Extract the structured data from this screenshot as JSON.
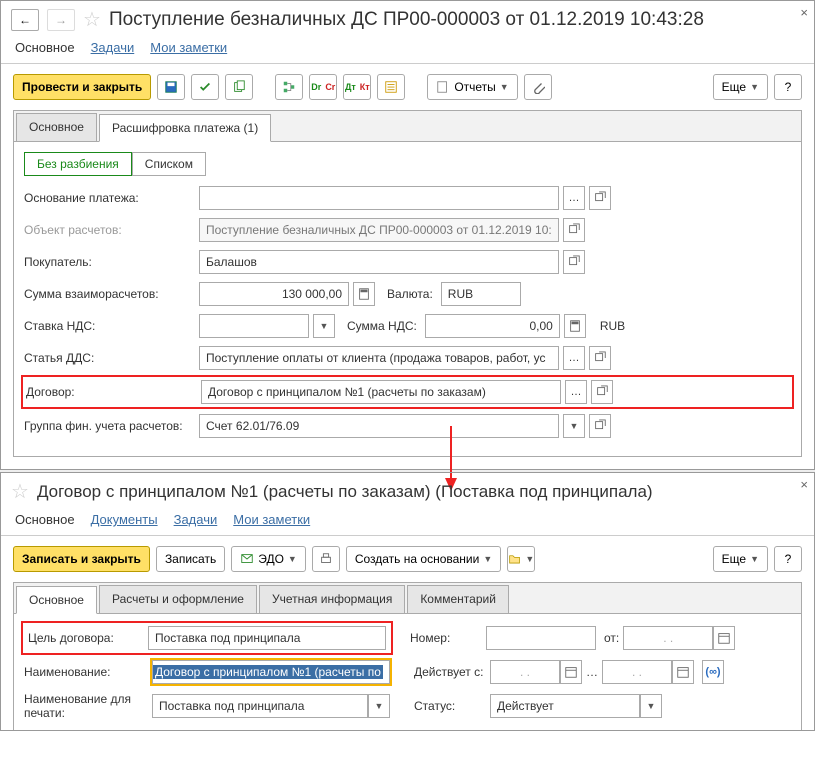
{
  "top": {
    "title": "Поступление безналичных ДС ПР00-000003 от 01.12.2019 10:43:28",
    "nav": {
      "main": "Основное",
      "tasks": "Задачи",
      "notes": "Мои заметки"
    },
    "toolbar": {
      "post_close": "Провести и закрыть",
      "reports": "Отчеты",
      "more": "Еще"
    },
    "main_tabs": {
      "t1": "Основное",
      "t2": "Расшифровка платежа (1)"
    },
    "toggle": {
      "t1": "Без разбиения",
      "t2": "Списком"
    },
    "fields": {
      "basis_label": "Основание платежа:",
      "basis_value": "",
      "calcobj_label": "Объект расчетов:",
      "calcobj_value": "Поступление безналичных ДС ПР00-000003 от 01.12.2019 10:",
      "buyer_label": "Покупатель:",
      "buyer_value": "Балашов",
      "sum_label": "Сумма взаиморасчетов:",
      "sum_value": "130 000,00",
      "curr_label": "Валюта:",
      "curr_value": "RUB",
      "vat_label": "Ставка НДС:",
      "vat_value": "",
      "vat_sum_label": "Сумма НДС:",
      "vat_sum_value": "0,00",
      "vat_curr": "RUB",
      "cashflow_label": "Статья ДДС:",
      "cashflow_value": "Поступление оплаты от клиента (продажа товаров, работ, ус",
      "contract_label": "Договор:",
      "contract_value": "Договор с принципалом №1 (расчеты по заказам)",
      "finacct_label": "Группа фин. учета расчетов:",
      "finacct_value": "Счет 62.01/76.09"
    }
  },
  "bottom": {
    "title": "Договор с принципалом №1 (расчеты по заказам) (Поставка под принципала)",
    "nav": {
      "main": "Основное",
      "docs": "Документы",
      "tasks": "Задачи",
      "notes": "Мои заметки"
    },
    "toolbar": {
      "write_close": "Записать и закрыть",
      "write": "Записать",
      "edo": "ЭДО",
      "create_based": "Создать на основании",
      "more": "Еще"
    },
    "main_tabs": {
      "t1": "Основное",
      "t2": "Расчеты и оформление",
      "t3": "Учетная информация",
      "t4": "Комментарий"
    },
    "fields": {
      "purpose_label": "Цель договора:",
      "purpose_value": "Поставка под принципала",
      "number_label": "Номер:",
      "number_value": "",
      "from_label": "от:",
      "from_value": ".  .",
      "name_label": "Наименование:",
      "name_value": "Договор с принципалом №1 (расчеты по",
      "valid_label": "Действует с:",
      "valid_value": ".  .",
      "valid_sep": "…",
      "valid_to": ".  .",
      "printname_label": "Наименование для печати:",
      "printname_value": "Поставка под принципала",
      "status_label": "Статус:",
      "status_value": "Действует"
    }
  }
}
